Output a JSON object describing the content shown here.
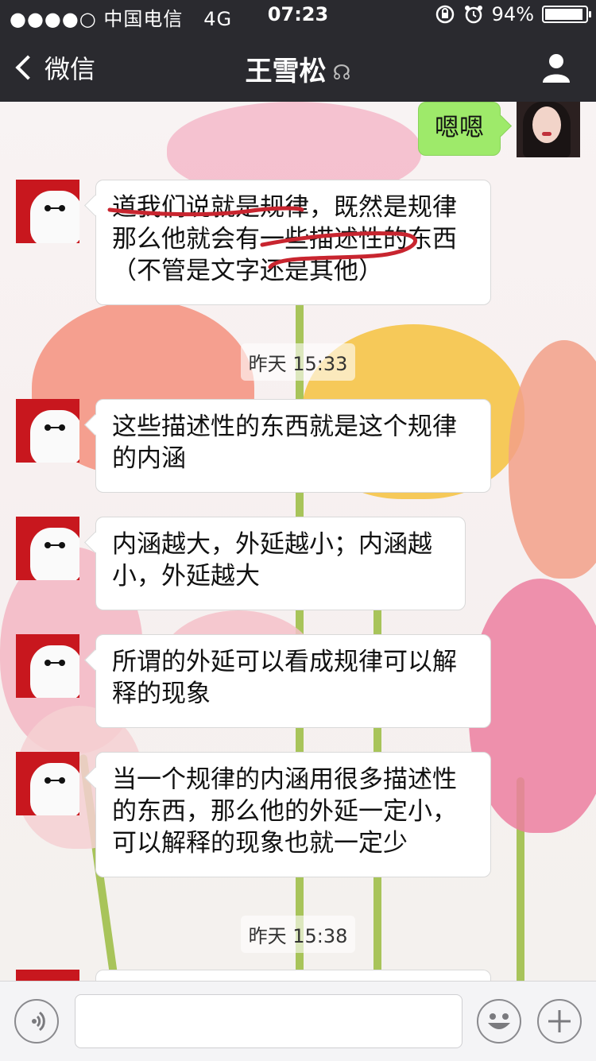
{
  "status_bar": {
    "signal": "●●●●○",
    "carrier": "中国电信",
    "network": "4G",
    "time": "07:23",
    "battery_text": "94%",
    "battery_level": 0.94
  },
  "nav": {
    "back_label": "微信",
    "title": "王雪松"
  },
  "messages": [
    {
      "side": "right",
      "text": "嗯嗯"
    },
    {
      "side": "left",
      "lines": [
        "道我们说就是规律，既然是规律",
        "那么他就会有一些描述性的东西",
        "（不管是文字还是其他）"
      ]
    },
    {
      "type": "time",
      "text": "昨天 15:33"
    },
    {
      "side": "left",
      "lines": [
        "这些描述性的东西就是这个规律",
        "的内涵"
      ]
    },
    {
      "side": "left",
      "lines": [
        "内涵越大，外延越小；内涵越",
        "小，外延越大"
      ]
    },
    {
      "side": "left",
      "lines": [
        "所谓的外延可以看成规律可以解",
        "释的现象"
      ]
    },
    {
      "side": "left",
      "lines": [
        "当一个规律的内涵用很多描述性",
        "的东西，那么他的外延一定小，",
        "可以解释的现象也就一定少"
      ]
    },
    {
      "type": "time",
      "text": "昨天 15:38"
    }
  ],
  "colors": {
    "nav_bg": "#2a2a2f",
    "bubble_green": "#9eea6a",
    "scribble_red": "#c8252f"
  },
  "icons": {
    "back": "chevron-left-icon",
    "earpiece": "ear-icon",
    "profile": "person-icon",
    "voice": "voice-icon",
    "emoji": "emoji-icon",
    "more": "plus-icon"
  }
}
